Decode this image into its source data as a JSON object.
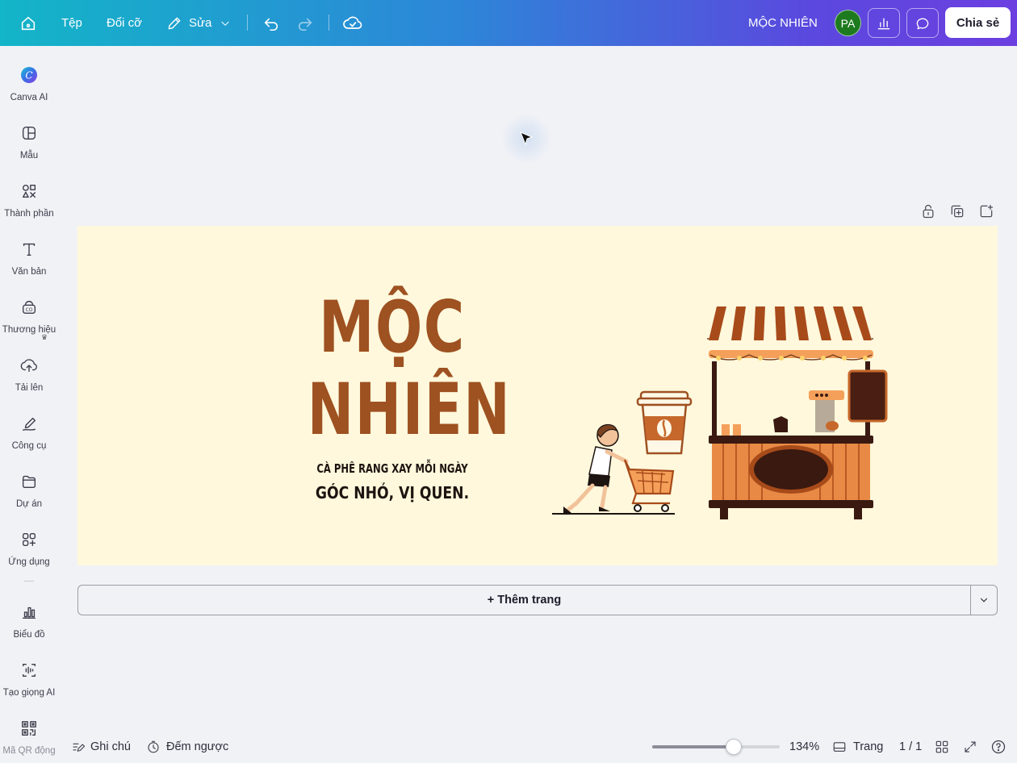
{
  "topbar": {
    "home_icon": "home-icon",
    "file_label": "Tệp",
    "resize_label": "Đổi cỡ",
    "edit_label": "Sửa",
    "project_title": "MỘC NHIÊN",
    "avatar_initials": "PA",
    "share_label": "Chia sẻ",
    "gradient_colors": [
      "#13b5c8",
      "#2d86d8",
      "#5b48de",
      "#6c3fe0"
    ]
  },
  "sidebar": {
    "items": [
      {
        "label": "Canva AI",
        "icon": "canva-ai-icon"
      },
      {
        "label": "Mẫu",
        "icon": "template-icon"
      },
      {
        "label": "Thành phần",
        "icon": "elements-icon"
      },
      {
        "label": "Văn bản",
        "icon": "text-icon"
      },
      {
        "label": "Thương hiệu",
        "icon": "brand-icon"
      },
      {
        "label": "Tải lên",
        "icon": "upload-icon"
      },
      {
        "label": "Công cụ",
        "icon": "draw-tool-icon"
      },
      {
        "label": "Dự án",
        "icon": "folder-icon"
      },
      {
        "label": "Ứng dụng",
        "icon": "apps-icon"
      },
      {
        "label": "Biểu đồ",
        "icon": "bar-chart-icon"
      },
      {
        "label": "Tạo giọng AI",
        "icon": "ai-voice-icon"
      },
      {
        "label": "Mã QR động",
        "icon": "qr-code-icon"
      }
    ]
  },
  "design": {
    "title_line1": "MỘC",
    "title_line2": "NHIÊN",
    "tagline1": "CÀ PHÊ RANG XAY MỖI NGÀY",
    "tagline2": "GÓC NHỎ, VỊ QUEN.",
    "background": "#fff8dc",
    "accent": "#9e5121"
  },
  "canvas": {
    "add_page_label": "+ Thêm trang"
  },
  "bottombar": {
    "notes_label": "Ghi chú",
    "timer_label": "Đếm ngược",
    "zoom_label": "134%",
    "zoom_fraction": 0.64,
    "pages_label": "Trang",
    "page_count": "1 / 1"
  }
}
